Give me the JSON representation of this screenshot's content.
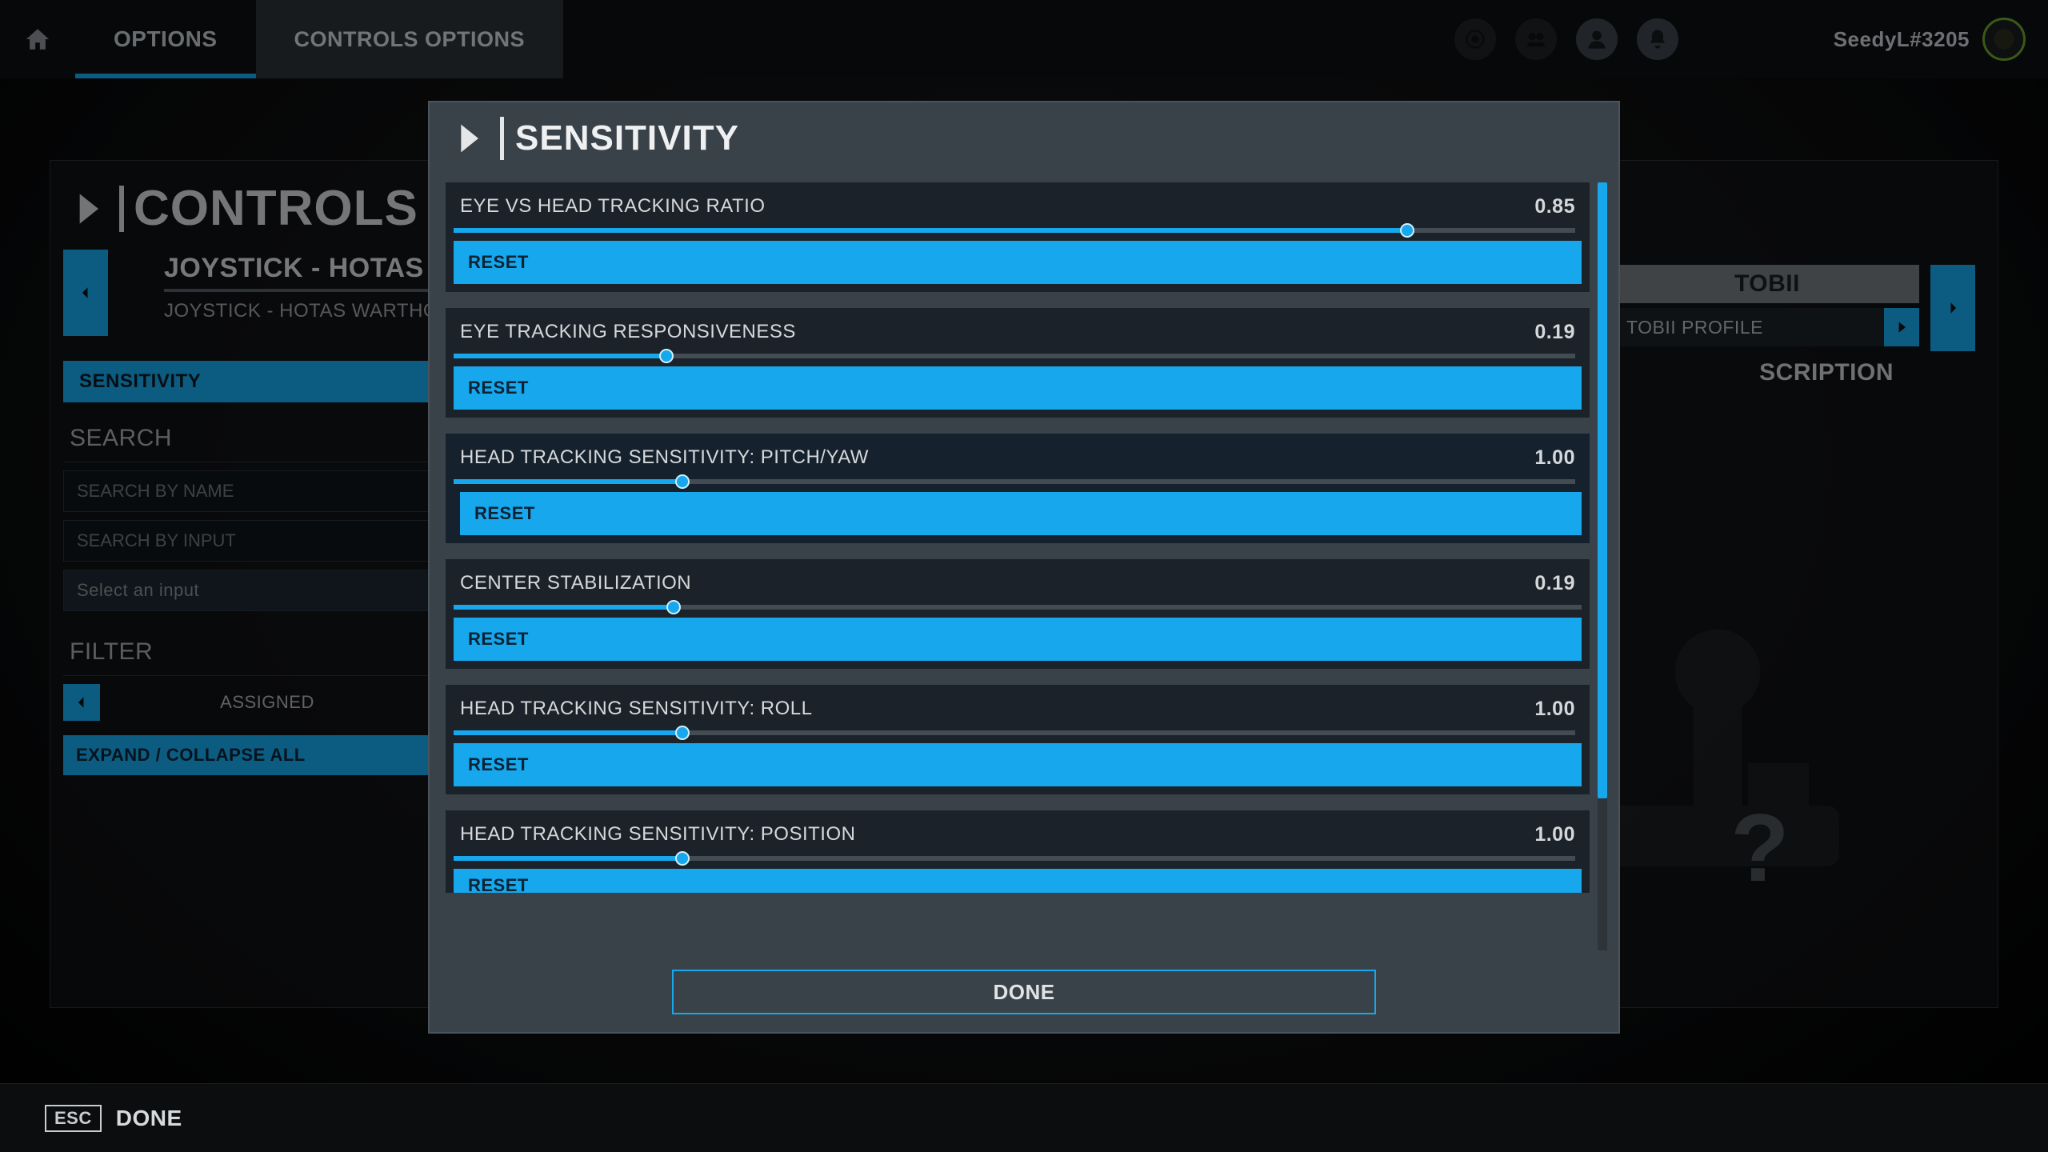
{
  "topbar": {
    "home": "HOME",
    "options": "OPTIONS",
    "controls_options": "CONTROLS OPTIONS"
  },
  "user": {
    "name": "SeedyL#3205"
  },
  "page": {
    "title": "CONTROLS O",
    "device_title": "JOYSTICK - HOTAS WA",
    "device_sub": "JOYSTICK - HOTAS WARTHOG",
    "description_label": "SCRIPTION"
  },
  "tobii": {
    "title": "TOBII",
    "profile": "TOBII PROFILE"
  },
  "sidebar": {
    "sensitivity": "SENSITIVITY",
    "search_label": "SEARCH",
    "search_name_ph": "SEARCH BY NAME",
    "search_input_ph": "SEARCH BY INPUT",
    "select_ph": "Select an input",
    "filter_label": "FILTER",
    "filter_value": "ASSIGNED",
    "expand": "EXPAND / COLLAPSE ALL"
  },
  "bottom": {
    "esc": "ESC",
    "done": "DONE"
  },
  "modal": {
    "title": "SENSITIVITY",
    "done": "DONE",
    "reset": "RESET",
    "sliders": [
      {
        "label": "EYE VS HEAD TRACKING RATIO",
        "value": "0.85",
        "pct": 85
      },
      {
        "label": "EYE TRACKING RESPONSIVENESS",
        "value": "0.19",
        "pct": 19
      },
      {
        "label": "HEAD TRACKING SENSITIVITY: PITCH/YAW",
        "value": "1.00",
        "pct": 20.4,
        "hl": true
      },
      {
        "label": "CENTER STABILIZATION",
        "value": "0.19",
        "pct": 19.5,
        "wide": true
      },
      {
        "label": "HEAD TRACKING SENSITIVITY: ROLL",
        "value": "1.00",
        "pct": 20.4
      },
      {
        "label": "HEAD TRACKING SENSITIVITY: POSITION",
        "value": "1.00",
        "pct": 20.4,
        "cut": true
      }
    ]
  }
}
